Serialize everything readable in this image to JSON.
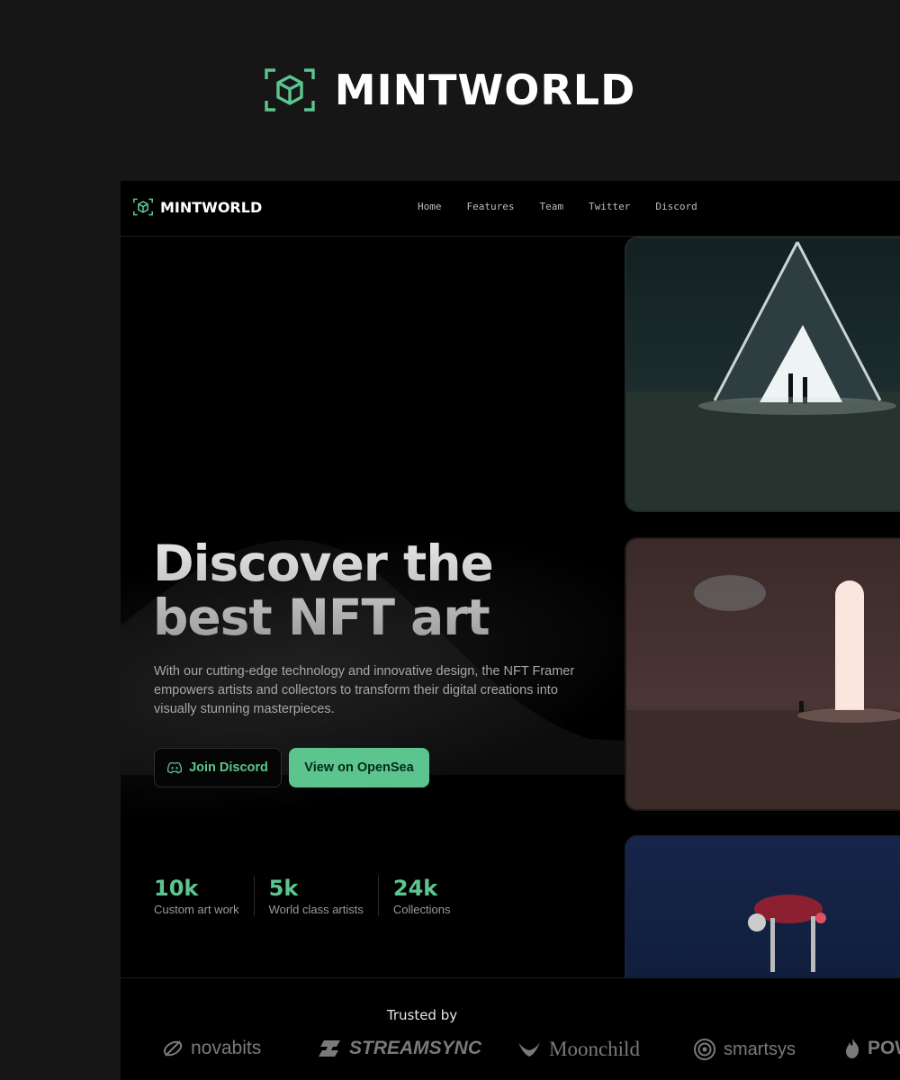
{
  "brand": {
    "name": "MINTWORLD",
    "accent": "#5cc58f"
  },
  "nav": {
    "links": [
      "Home",
      "Features",
      "Team",
      "Twitter",
      "Discord"
    ]
  },
  "hero": {
    "title_line1": "Discover the",
    "title_line2": "best NFT art",
    "description": "With our cutting-edge technology and innovative design, the NFT Framer empowers artists and collectors to transform their digital creations into visually stunning masterpieces.",
    "join_button": "Join Discord",
    "opensea_button": "View on OpenSea"
  },
  "stats": [
    {
      "value": "10k",
      "label": "Custom art work"
    },
    {
      "value": "5k",
      "label": "World class artists"
    },
    {
      "value": "24k",
      "label": "Collections"
    }
  ],
  "trusted": {
    "label": "Trusted by",
    "brands": [
      "novabits",
      "STREAMSYNC",
      "Moonchild",
      "smartsys",
      "POW"
    ]
  }
}
